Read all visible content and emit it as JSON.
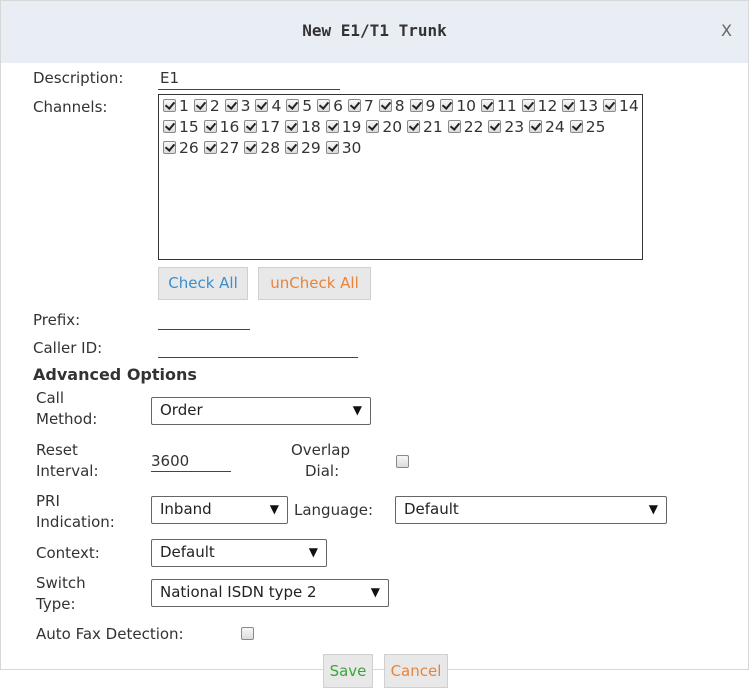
{
  "dialog": {
    "title": "New E1/T1 Trunk",
    "close": "X"
  },
  "form": {
    "description_label": "Description:",
    "description_value": "E1",
    "channels_label": "Channels:",
    "channels": [
      {
        "label": "1",
        "checked": true
      },
      {
        "label": "2",
        "checked": true
      },
      {
        "label": "3",
        "checked": true
      },
      {
        "label": "4",
        "checked": true
      },
      {
        "label": "5",
        "checked": true
      },
      {
        "label": "6",
        "checked": true
      },
      {
        "label": "7",
        "checked": true
      },
      {
        "label": "8",
        "checked": true
      },
      {
        "label": "9",
        "checked": true
      },
      {
        "label": "10",
        "checked": true
      },
      {
        "label": "11",
        "checked": true
      },
      {
        "label": "12",
        "checked": true
      },
      {
        "label": "13",
        "checked": true
      },
      {
        "label": "14",
        "checked": true
      },
      {
        "label": "15",
        "checked": true
      },
      {
        "label": "16",
        "checked": true
      },
      {
        "label": "17",
        "checked": true
      },
      {
        "label": "18",
        "checked": true
      },
      {
        "label": "19",
        "checked": true
      },
      {
        "label": "20",
        "checked": true
      },
      {
        "label": "21",
        "checked": true
      },
      {
        "label": "22",
        "checked": true
      },
      {
        "label": "23",
        "checked": true
      },
      {
        "label": "24",
        "checked": true
      },
      {
        "label": "25",
        "checked": true
      },
      {
        "label": "26",
        "checked": true
      },
      {
        "label": "27",
        "checked": true
      },
      {
        "label": "28",
        "checked": true
      },
      {
        "label": "29",
        "checked": true
      },
      {
        "label": "30",
        "checked": true
      }
    ],
    "check_all": "Check All",
    "uncheck_all": "unCheck All",
    "prefix_label": "Prefix:",
    "prefix_value": "",
    "callerid_label": "Caller ID:",
    "callerid_value": "",
    "advanced_title": "Advanced Options",
    "call_method_label1": "Call",
    "call_method_label2": "Method:",
    "call_method_value": "Order",
    "reset_label1": "Reset",
    "reset_label2": "Interval:",
    "reset_value": "3600",
    "overlap_label1": "Overlap",
    "overlap_label2": "Dial:",
    "overlap_checked": false,
    "pri_label1": "PRI",
    "pri_label2": "Indication:",
    "pri_value": "Inband",
    "language_label": "Language:",
    "language_value": "Default",
    "context_label": "Context:",
    "context_value": "Default",
    "switch_label1": "Switch",
    "switch_label2": "Type:",
    "switch_value": "National ISDN type 2",
    "autofax_label": "Auto Fax Detection:",
    "autofax_checked": false,
    "dropdown_arrow": "▼"
  },
  "footer": {
    "save": "Save",
    "cancel": "Cancel"
  },
  "colors": {
    "check_all": "#3a8fd0",
    "uncheck_all": "#e8843a",
    "save": "#3aa53a",
    "cancel": "#e8843a",
    "titlebar": "#e9eef4"
  }
}
